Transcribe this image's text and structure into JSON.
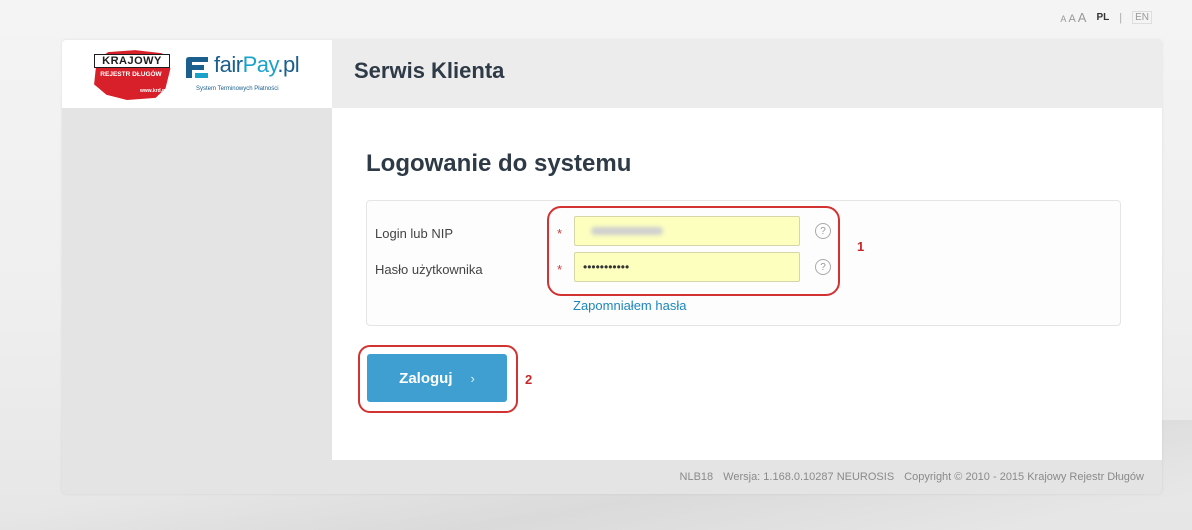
{
  "top_bar": {
    "font_size_small": "A",
    "font_size_medium": "A",
    "font_size_large": "A",
    "lang_pl": "PL",
    "lang_separator": "|",
    "lang_en": "EN"
  },
  "logos": {
    "krd_top": "KRAJOWY",
    "krd_mid": "REJESTR DŁUGÓW",
    "krd_url": "www.krd.pl",
    "fairpay_fair": "fair",
    "fairpay_pay": "Pay",
    "fairpay_tld": ".pl",
    "fairpay_tagline": "System Terminowych Płatności",
    "fairpay_icon": "fairpay-f-icon",
    "colors": {
      "krd_red": "#d8202a",
      "fairpay_blue": "#1b5f8f",
      "fairpay_cyan": "#19a3c9"
    }
  },
  "header": {
    "title": "Serwis Klienta"
  },
  "login": {
    "title": "Logowanie do systemu",
    "fields": [
      {
        "label": "Login lub NIP",
        "required_mark": "*",
        "value": "",
        "help_icon": "?"
      },
      {
        "label": "Hasło użytkownika",
        "required_mark": "*",
        "value": "•••••••••••",
        "help_icon": "?"
      }
    ],
    "forgot_password": "Zapomniałem hasła",
    "submit_label": "Zaloguj",
    "submit_chevron": "›",
    "colors": {
      "button": "#3f9fd1",
      "input_bg": "#fcffbe",
      "annotation": "#d23232",
      "link": "#1d87bd"
    }
  },
  "annotations": {
    "fields_marker": "1",
    "button_marker": "2"
  },
  "footer": {
    "code": "NLB18",
    "version": "Wersja: 1.168.0.10287 NEUROSIS",
    "copyright": "Copyright © 2010 - 2015 Krajowy Rejestr Długów"
  }
}
